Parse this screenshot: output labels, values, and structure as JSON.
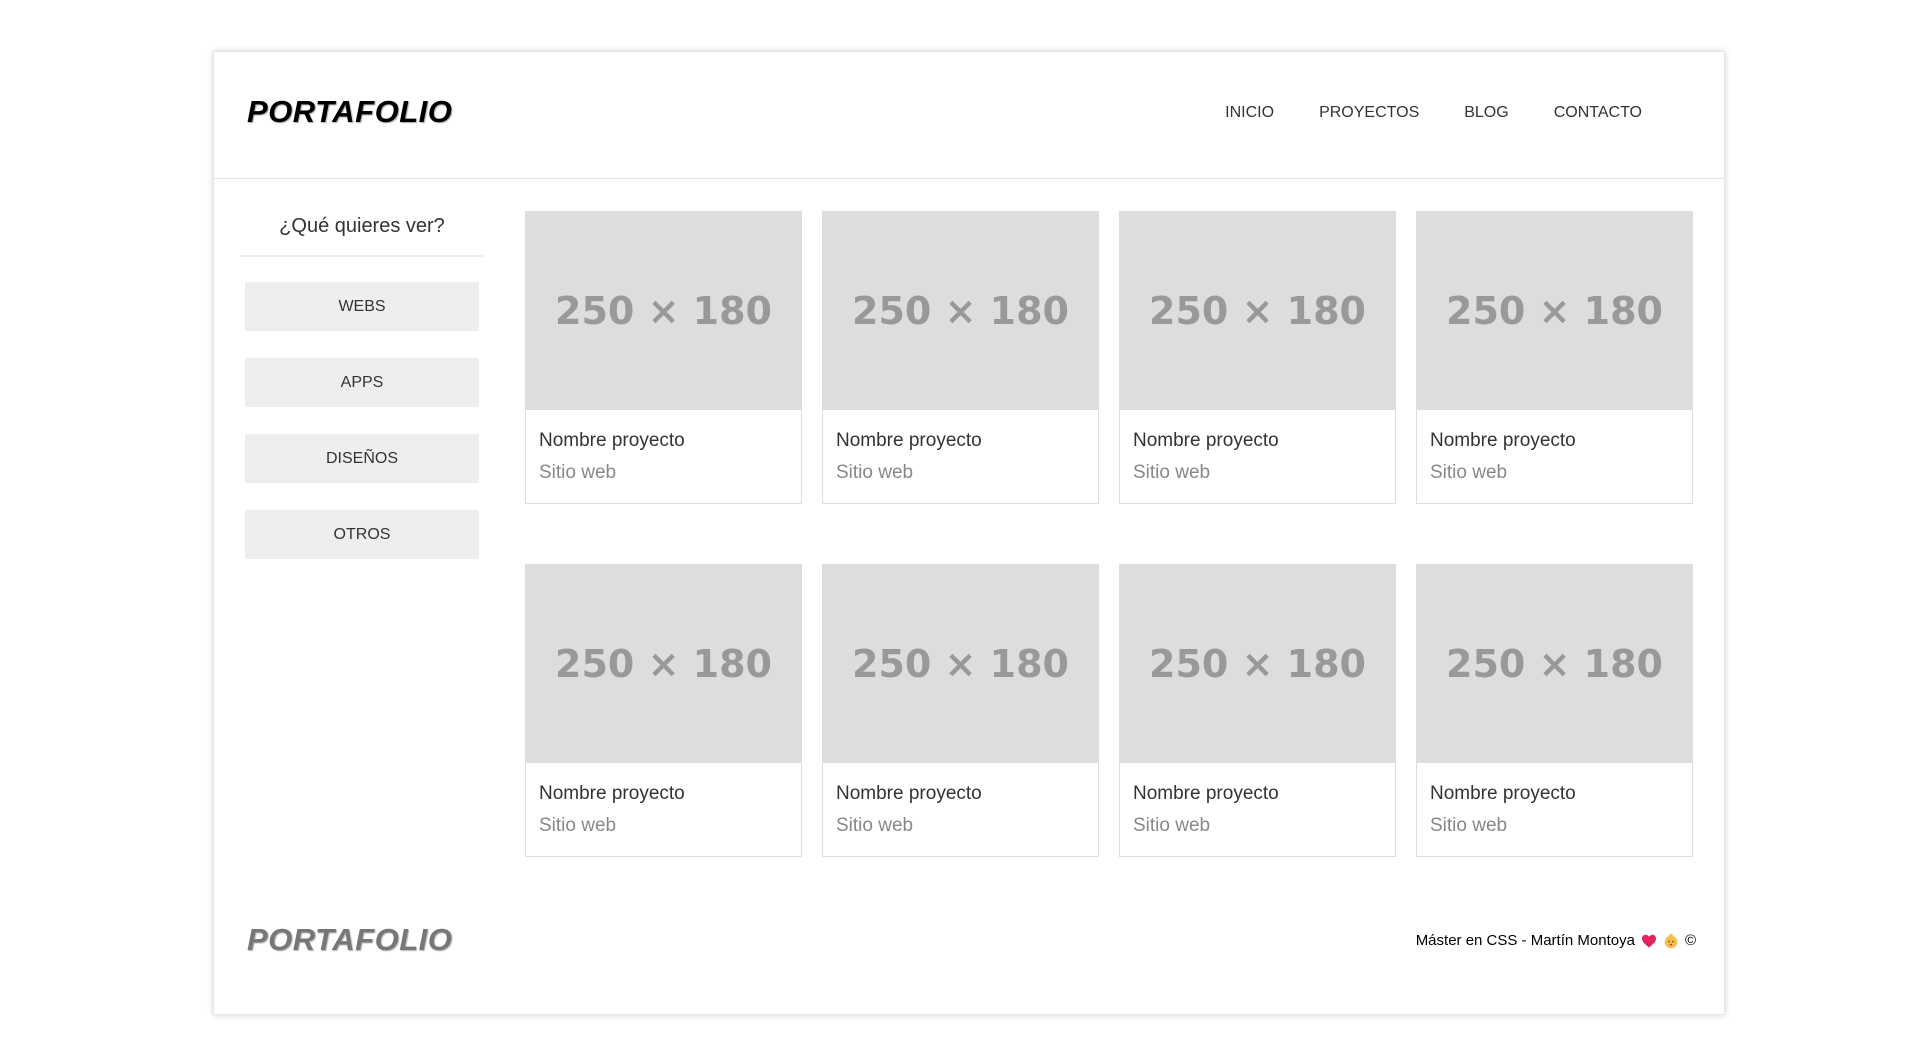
{
  "header": {
    "logo": "PORTAFOLIO",
    "nav": [
      "INICIO",
      "PROYECTOS",
      "BLOG",
      "CONTACTO"
    ]
  },
  "sidebar": {
    "title": "¿Qué quieres ver?",
    "filters": [
      "WEBS",
      "APPS",
      "DISEÑOS",
      "OTROS"
    ]
  },
  "projects": [
    {
      "thumb": "250 × 180",
      "title": "Nombre proyecto",
      "subtitle": "Sitio web"
    },
    {
      "thumb": "250 × 180",
      "title": "Nombre proyecto",
      "subtitle": "Sitio web"
    },
    {
      "thumb": "250 × 180",
      "title": "Nombre proyecto",
      "subtitle": "Sitio web"
    },
    {
      "thumb": "250 × 180",
      "title": "Nombre proyecto",
      "subtitle": "Sitio web"
    },
    {
      "thumb": "250 × 180",
      "title": "Nombre proyecto",
      "subtitle": "Sitio web"
    },
    {
      "thumb": "250 × 180",
      "title": "Nombre proyecto",
      "subtitle": "Sitio web"
    },
    {
      "thumb": "250 × 180",
      "title": "Nombre proyecto",
      "subtitle": "Sitio web"
    },
    {
      "thumb": "250 × 180",
      "title": "Nombre proyecto",
      "subtitle": "Sitio web"
    }
  ],
  "footer": {
    "logo": "PORTAFOLIO",
    "credit": "Máster en CSS - Martín Montoya",
    "icons": [
      "heart-icon",
      "baby-icon"
    ],
    "copyright": "©"
  },
  "colors": {
    "thumb_bg": "#dddddd",
    "filter_bg": "#eeeeee",
    "heart": "#e0245e"
  }
}
